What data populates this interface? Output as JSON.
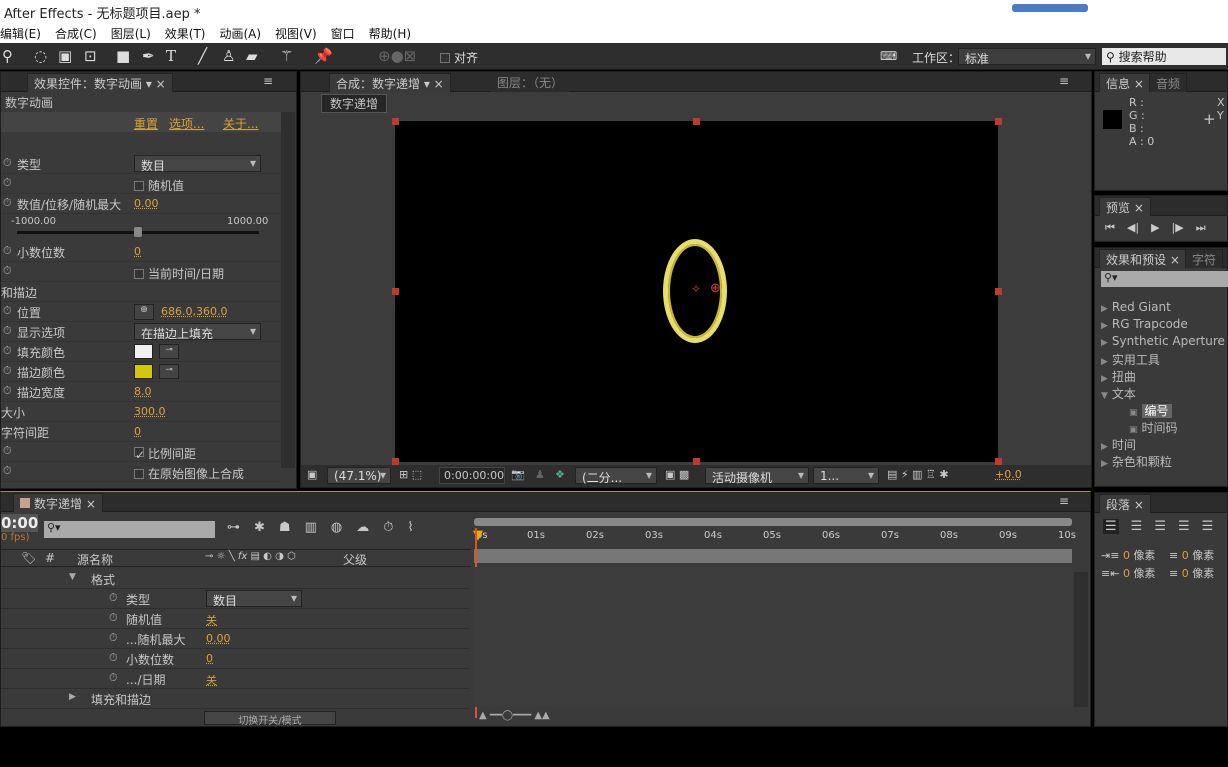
{
  "window": {
    "title": "After Effects - 无标题项目.aep *"
  },
  "menu": [
    "编辑(E)",
    "合成(C)",
    "图层(L)",
    "效果(T)",
    "动画(A)",
    "视图(V)",
    "窗口",
    "帮助(H)"
  ],
  "toolbar": {
    "snap_label": "对齐",
    "workspace_label": "工作区：",
    "workspace_value": "标准",
    "search_placeholder": "搜索帮助"
  },
  "effect_controls": {
    "tab": "效果控件：数字动画",
    "layer": "数字动画",
    "links": [
      "重置",
      "选项...",
      "关于..."
    ],
    "slider_min": "-1000.00",
    "slider_max": "1000.00",
    "slider_value": 0.5,
    "rows": [
      {
        "label": "类型",
        "dropdown": "数目"
      },
      {
        "label": "",
        "checkbox": "随机值",
        "checked": false
      },
      {
        "label": "数值/位移/随机最大",
        "value": "0.00"
      },
      {
        "label": "小数位数",
        "value": "0"
      },
      {
        "label": "",
        "checkbox": "当前时间/日期",
        "checked": false
      },
      {
        "label": "和描边",
        "section": true
      },
      {
        "label": "位置",
        "value": "686.0,360.0"
      },
      {
        "label": "显示选项",
        "dropdown": "在描边上填充"
      },
      {
        "label": "填充颜色",
        "color": "#f0f0f0"
      },
      {
        "label": "描边颜色",
        "color": "#d4c900"
      },
      {
        "label": "描边宽度",
        "value": "8.0"
      },
      {
        "label": "大小",
        "value": "300.0",
        "section": true
      },
      {
        "label": "字符间距",
        "value": "0",
        "section": true
      },
      {
        "label": "",
        "checkbox": "比例间距",
        "checked": true
      },
      {
        "label": "",
        "checkbox": "在原始图像上合成",
        "checked": false
      }
    ]
  },
  "composition": {
    "tab": "合成：数字递增",
    "layer_tab": "图层：（无）",
    "comp_chip": "数字递增",
    "displayed_digit": "0",
    "zoom": "(47.1%)",
    "timecode": "0:00:00:00",
    "resolution": "(二分...",
    "camera": "活动摄像机",
    "views": "1...",
    "exposure": "+0.0"
  },
  "info": {
    "tabs": [
      "信息",
      "音频"
    ],
    "r": "R :",
    "g": "G :",
    "b": "B :",
    "a": "A : 0",
    "x": "X",
    "y": "Y"
  },
  "preview": {
    "tab": "预览"
  },
  "effects_presets": {
    "tabs": [
      "效果和预设",
      "字符"
    ],
    "items": [
      {
        "label": "Red Giant",
        "type": "folder"
      },
      {
        "label": "RG Trapcode",
        "type": "folder"
      },
      {
        "label": "Synthetic Aperture",
        "type": "folder"
      },
      {
        "label": "实用工具",
        "type": "folder"
      },
      {
        "label": "扭曲",
        "type": "folder"
      },
      {
        "label": "文本",
        "type": "open"
      },
      {
        "label": "编号",
        "type": "effect",
        "selected": true
      },
      {
        "label": "时间码",
        "type": "effect"
      },
      {
        "label": "时间",
        "type": "folder"
      },
      {
        "label": "杂色和颗粒",
        "type": "folder"
      }
    ]
  },
  "paragraph": {
    "tab": "段落",
    "indent": [
      {
        "v": "0",
        "u": "像素"
      },
      {
        "v": "0",
        "u": "像素"
      },
      {
        "v": "0",
        "u": "像素"
      },
      {
        "v": "0",
        "u": "像素"
      }
    ]
  },
  "timeline": {
    "tab": "数字递增",
    "timecode": "0:00",
    "fps": "0 fps)",
    "col_hash": "#",
    "col_source": "源名称",
    "col_parent": "父级",
    "col_switches": "fx",
    "ruler": [
      "0s",
      "01s",
      "02s",
      "03s",
      "04s",
      "05s",
      "06s",
      "07s",
      "08s",
      "09s",
      "10s"
    ],
    "toggle_label": "切换开关/模式",
    "rows": [
      {
        "label": "格式",
        "indent": 1,
        "expand": "open"
      },
      {
        "label": "类型",
        "indent": 2,
        "dropdown": "数目"
      },
      {
        "label": "随机值",
        "indent": 2,
        "value": "关"
      },
      {
        "label": "...随机最大",
        "indent": 2,
        "value": "0.00"
      },
      {
        "label": "小数位数",
        "indent": 2,
        "value": "0"
      },
      {
        "label": ".../日期",
        "indent": 2,
        "value": "关"
      },
      {
        "label": "填充和描边",
        "indent": 1,
        "expand": "closed"
      }
    ]
  }
}
